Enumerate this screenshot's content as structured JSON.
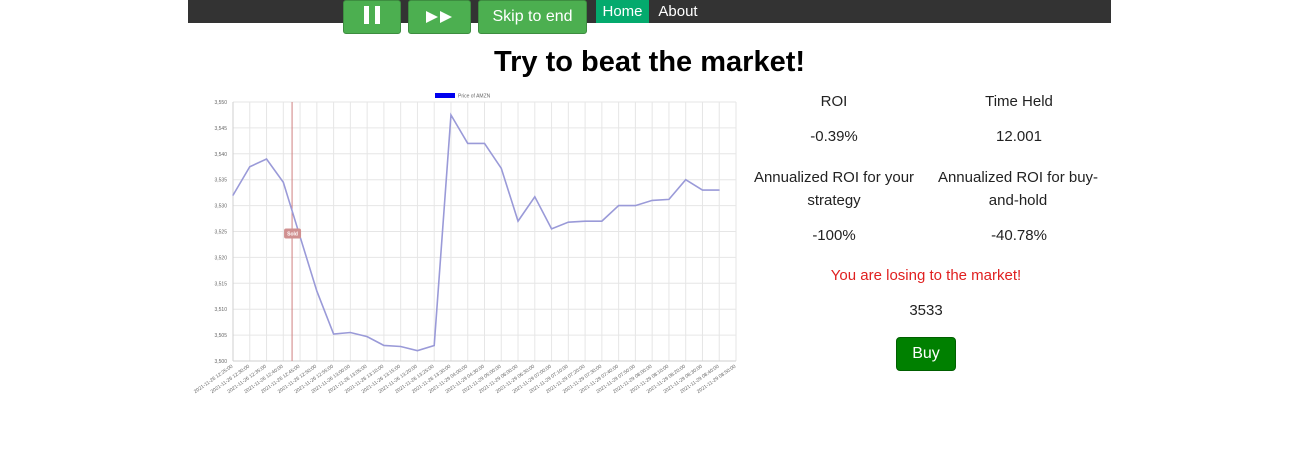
{
  "nav": {
    "items": [
      {
        "label": "Home",
        "active": true
      },
      {
        "label": "About",
        "active": false
      }
    ],
    "active_color": "#04aa6d"
  },
  "page": {
    "title": "Try to beat the market!"
  },
  "stats": {
    "roi_label": "ROI",
    "roi_value": "-0.39%",
    "time_held_label": "Time Held",
    "time_held_value": "12.001",
    "annualized_strategy_label": "Annualized ROI for your strategy",
    "annualized_strategy_value": "-100%",
    "annualized_hold_label": "Annualized ROI for buy-and-hold",
    "annualized_hold_value": "-40.78%",
    "status_message": "You are losing to the market!",
    "status_color": "#e02020",
    "current_price": "3533"
  },
  "buttons": {
    "buy": "Buy",
    "skip": "Skip to end",
    "pause_icon": "pause-icon",
    "fast_forward_icon": "fast-forward-icon"
  },
  "chart_data": {
    "type": "line",
    "legend": "Price of AMZN",
    "legend_position": "top",
    "grid": true,
    "ylim": [
      3500,
      3550
    ],
    "yticks": [
      "3,550",
      "3,545",
      "3,540",
      "3,535",
      "3,530",
      "3,525",
      "3,520",
      "3,515",
      "3,510",
      "3,505",
      "3,500"
    ],
    "line_color": "#9a9ad8",
    "categories": [
      "2021-11-26 12:25:00",
      "2021-11-26 12:30:00",
      "2021-11-26 12:35:00",
      "2021-11-26 12:40:00",
      "2021-11-26 12:45:00",
      "2021-11-26 12:50:00",
      "2021-11-26 12:55:00",
      "2021-11-26 13:00:00",
      "2021-11-26 13:05:00",
      "2021-11-26 13:10:00",
      "2021-11-26 13:15:00",
      "2021-11-26 13:20:00",
      "2021-11-26 13:25:00",
      "2021-11-26 13:30:00",
      "2021-11-29 04:00:00",
      "2021-11-29 04:30:00",
      "2021-11-29 05:00:00",
      "2021-11-29 06:00:00",
      "2021-11-29 06:30:00",
      "2021-11-29 07:00:00",
      "2021-11-29 07:10:00",
      "2021-11-29 07:20:00",
      "2021-11-29 07:30:00",
      "2021-11-29 07:40:00",
      "2021-11-29 07:50:00",
      "2021-11-29 08:00:00",
      "2021-11-29 08:10:00",
      "2021-11-29 08:20:00",
      "2021-11-29 08:30:00",
      "2021-11-29 08:40:00",
      "2021-11-29 08:50:00"
    ],
    "values": [
      3532,
      3537.5,
      3539,
      3534.5,
      3524,
      3513.5,
      3505.2,
      3505.5,
      3504.7,
      3503,
      3502.8,
      3502,
      3503,
      3547.5,
      3542,
      3542,
      3537.2,
      3527,
      3531.7,
      3525.5,
      3526.8,
      3527,
      3527,
      3530,
      3530,
      3531,
      3531.2,
      3535,
      3533,
      3533
    ],
    "annotation": {
      "label": "Sold",
      "index": 4,
      "line_color": "#d08080"
    }
  }
}
